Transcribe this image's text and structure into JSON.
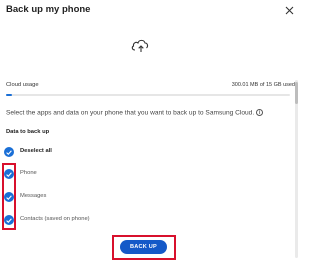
{
  "dialog": {
    "title": "Back up my phone"
  },
  "usage": {
    "label": "Cloud usage",
    "value": "300.01 MB of 15 GB used",
    "fraction": 0.02
  },
  "description": "Select the apps and data on your phone that you want to back up to Samsung Cloud.",
  "section": {
    "label": "Data to back up"
  },
  "items": [
    {
      "label": "Deselect all",
      "checked": true
    },
    {
      "label": "Phone",
      "checked": true
    },
    {
      "label": "Messages",
      "checked": true
    },
    {
      "label": "Contacts (saved on phone)",
      "checked": true
    }
  ],
  "actions": {
    "backup_label": "BACK UP"
  },
  "colors": {
    "accent": "#1a6fd6",
    "button": "#1459c8",
    "annotation": "#d8102c"
  },
  "icons": {
    "close": "close-icon",
    "cloud_upload": "cloud-upload-icon",
    "info": "info-icon",
    "check": "check-icon"
  }
}
